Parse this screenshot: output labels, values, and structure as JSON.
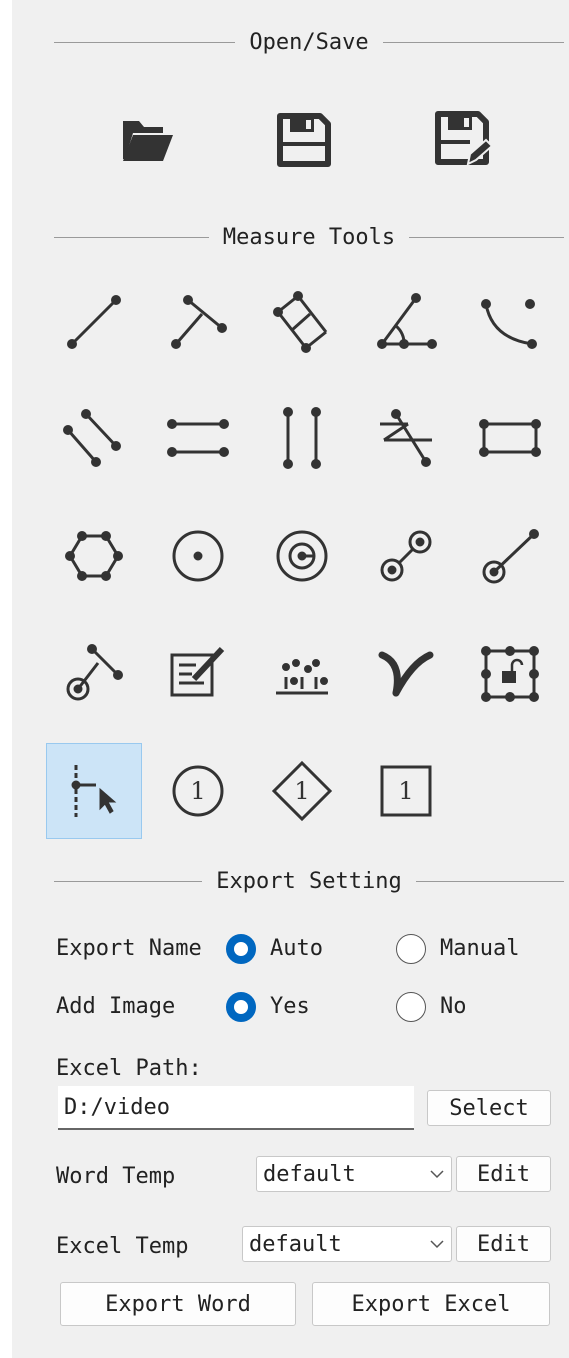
{
  "sections": {
    "open_save": "Open/Save",
    "measure_tools": "Measure Tools",
    "export_setting": "Export Setting"
  },
  "file_icons": [
    "open-folder-icon",
    "save-icon",
    "save-as-icon"
  ],
  "measure_tools": [
    "line-icon",
    "parallel-line-segment-icon",
    "dimension-line-icon",
    "angle-icon",
    "arc-icon",
    "diagonal-parallel-lines-icon",
    "horizontal-parallel-lines-icon",
    "vertical-parallel-lines-icon",
    "zigzag-line-icon",
    "rectangle-icon",
    "polygon-icon",
    "circle-center-icon",
    "concentric-circle-icon",
    "two-circles-distance-icon",
    "circle-to-point-icon",
    "circle-to-line-icon",
    "text-annotation-icon",
    "point-count-icon",
    "curve-icon",
    "lock-frame-icon",
    "point-to-line-icon",
    "circle-number-icon",
    "diamond-number-icon",
    "square-number-icon"
  ],
  "number_marker": "1",
  "export": {
    "export_name_label": "Export Name",
    "export_name_options": [
      "Auto",
      "Manual"
    ],
    "export_name_selected": "Auto",
    "add_image_label": "Add Image",
    "add_image_options": [
      "Yes",
      "No"
    ],
    "add_image_selected": "Yes",
    "excel_path_label": "Excel Path:",
    "excel_path_value": "D:/video",
    "select_button": "Select",
    "word_temp_label": "Word Temp",
    "word_temp_value": "default",
    "excel_temp_label": "Excel Temp",
    "excel_temp_value": "default",
    "edit_button": "Edit",
    "export_word_button": "Export Word",
    "export_excel_button": "Export Excel"
  },
  "colors": {
    "accent": "#0067c0",
    "selected_bg": "#cce4f7",
    "panel_bg": "#f0f0f0"
  }
}
